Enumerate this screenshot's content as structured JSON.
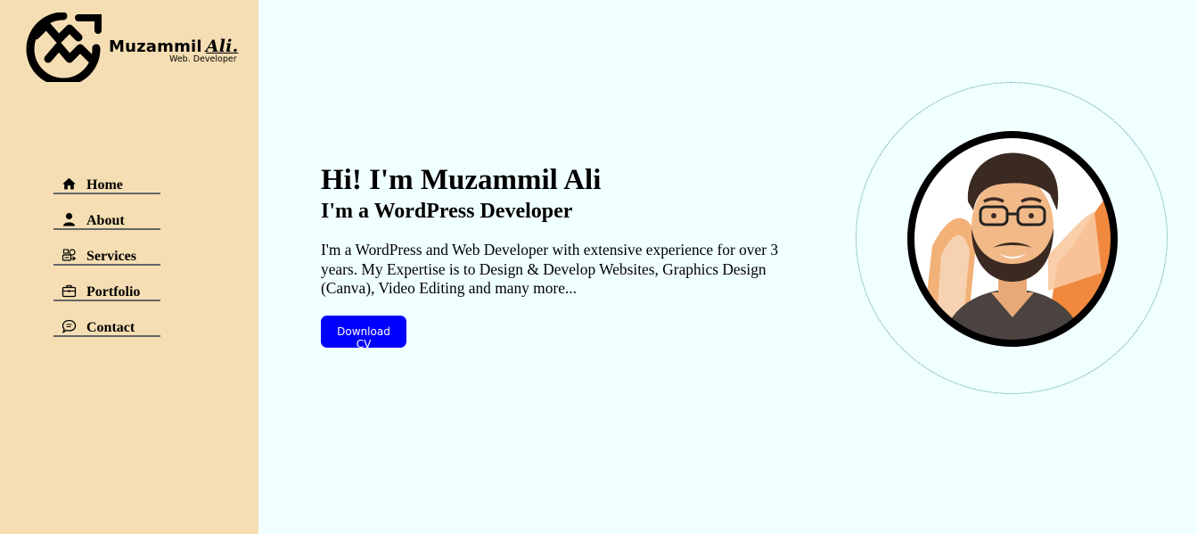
{
  "brand": {
    "name": "Muzammil",
    "name_accent": "Ali.",
    "tagline": "Web. Developer",
    "logo_icon": "mw-monogram-icon"
  },
  "nav": {
    "items": [
      {
        "label": "Home",
        "icon": "home-icon"
      },
      {
        "label": "About",
        "icon": "user-icon"
      },
      {
        "label": "Services",
        "icon": "services-icon"
      },
      {
        "label": "Portfolio",
        "icon": "briefcase-icon"
      },
      {
        "label": "Contact",
        "icon": "chat-icon"
      }
    ]
  },
  "hero": {
    "title": "Hi! I'm Muzammil Ali",
    "subtitle": "I'm a WordPress Developer",
    "description": "I'm a WordPress and Web Developer with extensive experience for over 3 years. My Expertise is to Design & Develop Websites, Graphics Design (Canva), Video Editing and many more...",
    "cta_label": "Download CV"
  },
  "colors": {
    "sidebar_bg": "#f5deb3",
    "page_bg": "#f0ffff",
    "button_bg": "#0000ff",
    "accent_orange": "#f0883e"
  }
}
